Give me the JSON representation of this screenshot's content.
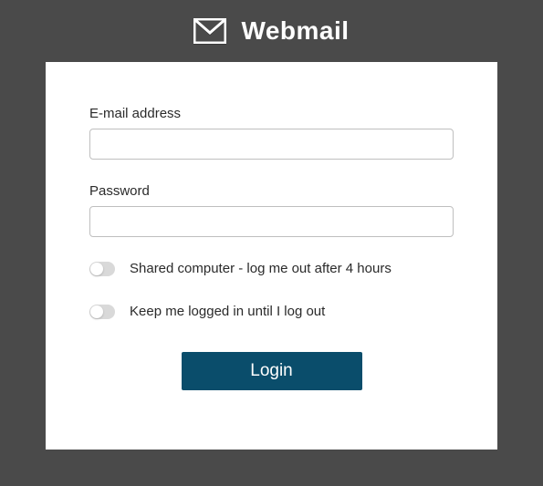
{
  "header": {
    "title": "Webmail"
  },
  "form": {
    "email_label": "E-mail address",
    "email_value": "",
    "password_label": "Password",
    "password_value": "",
    "shared_toggle_label": "Shared computer - log me out after 4 hours",
    "keep_logged_label": "Keep me logged in until I log out",
    "login_button": "Login"
  }
}
